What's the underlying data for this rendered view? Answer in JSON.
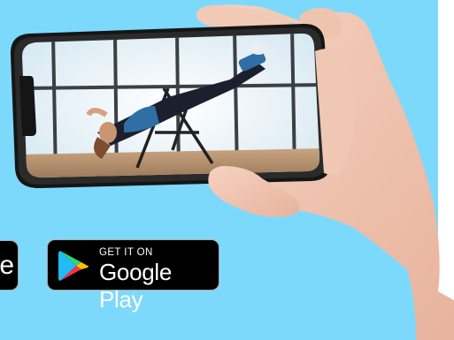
{
  "badges": {
    "apple": {
      "big_text": "e",
      "icon": "apple-icon"
    },
    "google": {
      "small_text": "GET IT ON",
      "big_text": "Google Play",
      "icon": "google-play-icon"
    }
  },
  "phone": {
    "screen_content": "person-on-inversion-table",
    "colors": {
      "sky": "#7dd9fb",
      "frame": "#1a1a1a",
      "window": "#e6f2f8"
    }
  }
}
